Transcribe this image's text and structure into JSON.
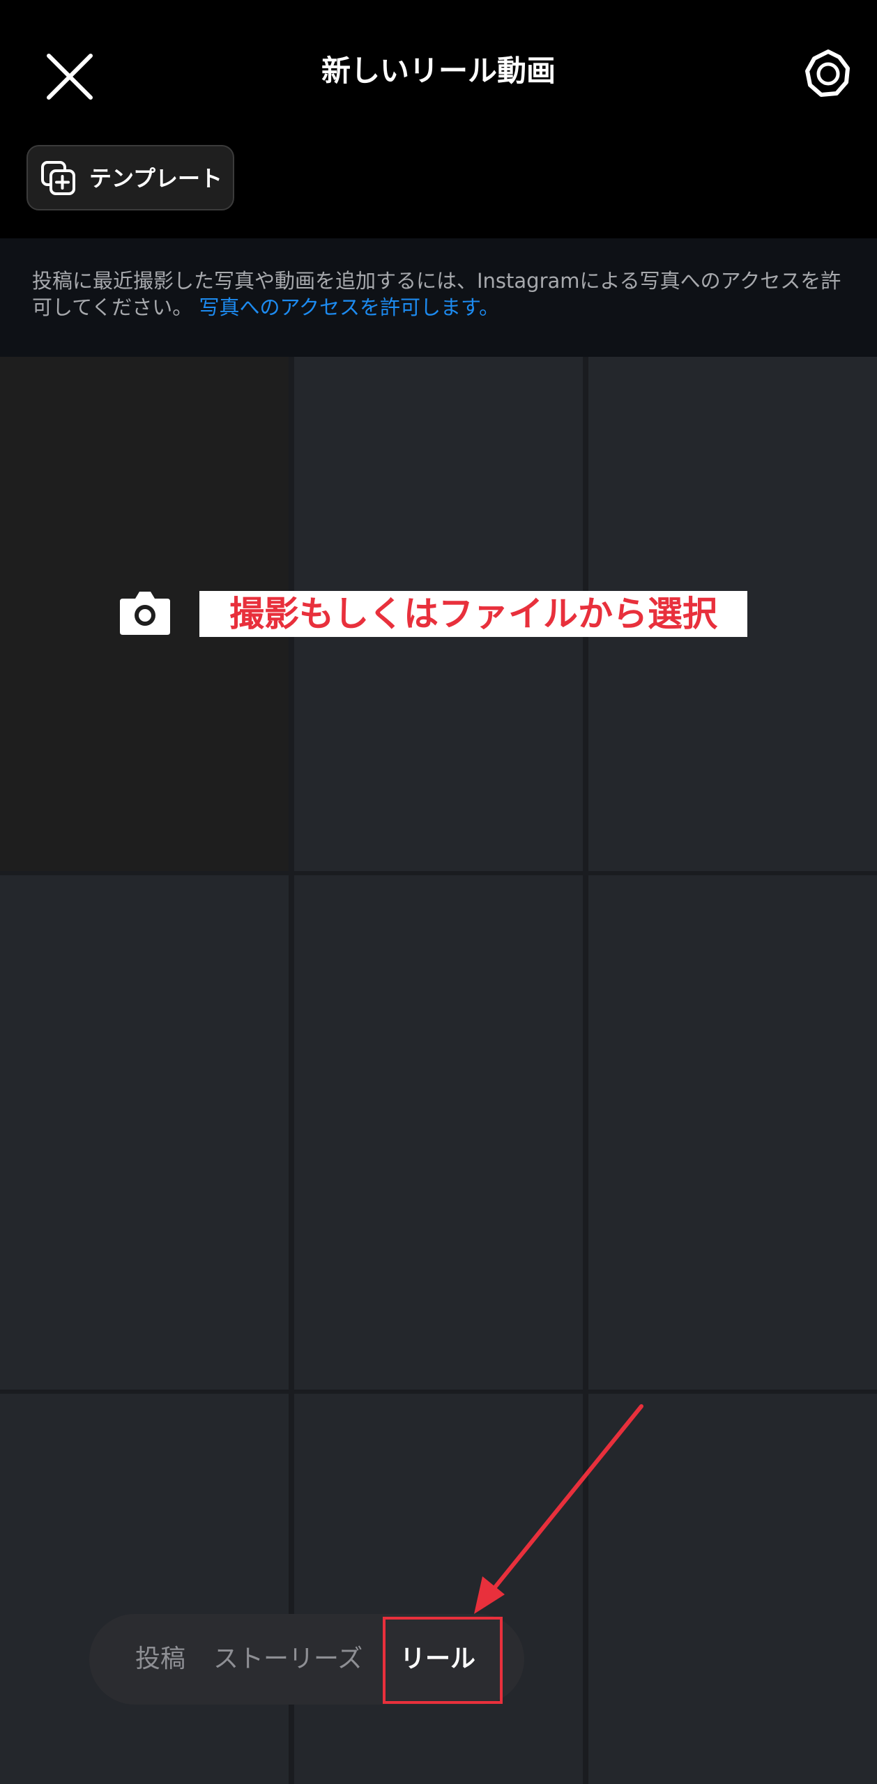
{
  "header": {
    "title": "新しいリール動画",
    "close_icon": "close-icon",
    "settings_icon": "settings-gear-icon"
  },
  "template_button": {
    "label": "テンプレート",
    "icon": "template-add-icon"
  },
  "notice": {
    "text": "投稿に最近撮影した写真や動画を追加するには、Instagramによる写真へのアクセスを許可してください。",
    "link": "写真へのアクセスを許可します。"
  },
  "gallery": {
    "camera_icon": "camera-icon",
    "annotation": "撮影もしくはファイルから選択"
  },
  "tabs": {
    "post": "投稿",
    "stories": "ストーリーズ",
    "reels": "リール",
    "selected": "リール"
  },
  "colors": {
    "background": "#000000",
    "notice_bg": "#0e1116",
    "cell": "#24272c",
    "link": "#1d8bf0",
    "annotation": "#e8303c"
  }
}
